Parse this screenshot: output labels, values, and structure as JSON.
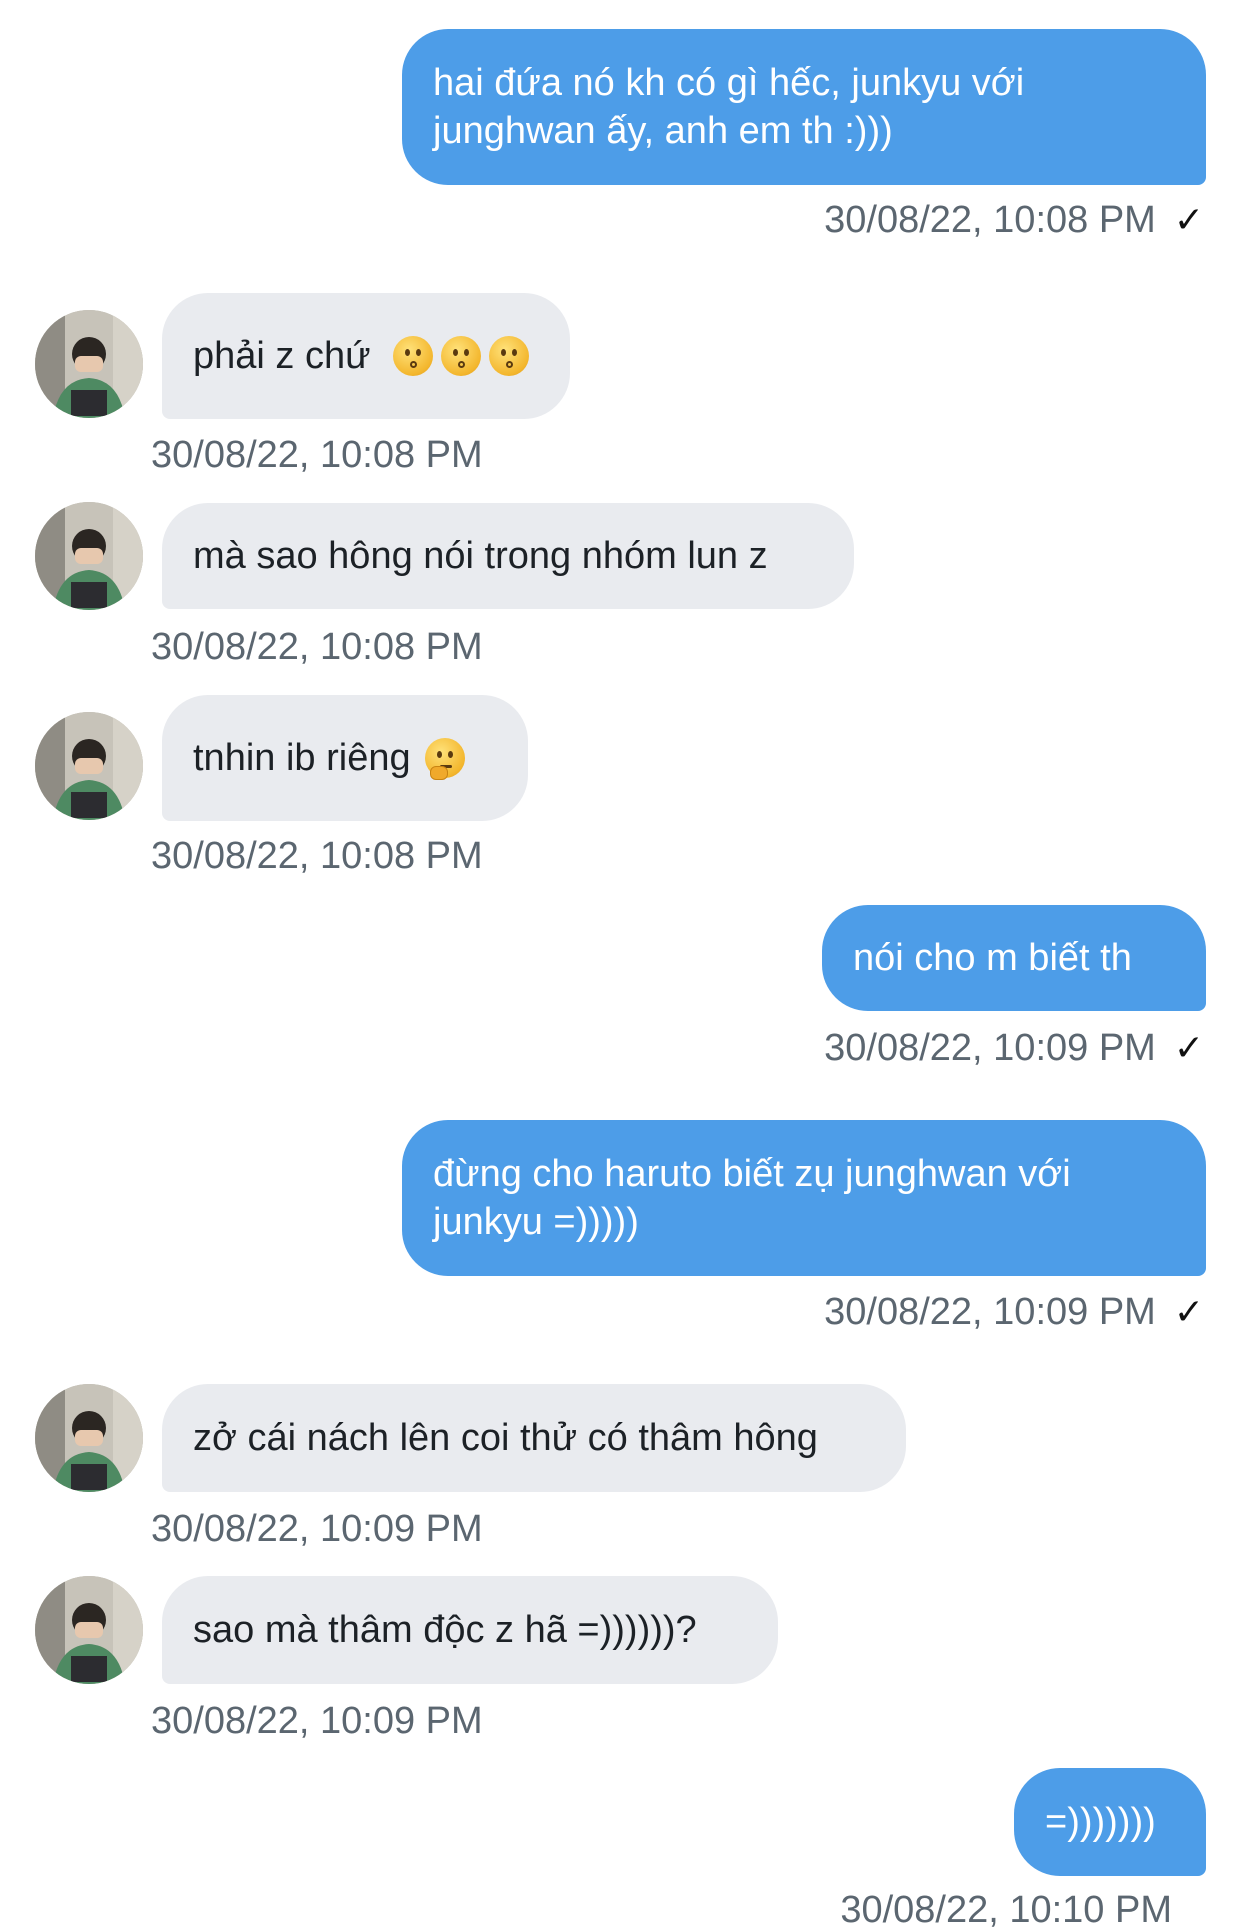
{
  "messages": [
    {
      "direction": "out",
      "text": "hai đứa nó kh có gì hếc, junkyu với junghwan ấy, anh em th :)))",
      "time": "30/08/22, 10:08 PM",
      "read_mark": "✓"
    },
    {
      "direction": "in",
      "text": "phải z chứ",
      "emoji": [
        "kissing-face-icon",
        "kissing-face-icon",
        "kissing-face-icon"
      ],
      "time": "30/08/22, 10:08 PM"
    },
    {
      "direction": "in",
      "text": "mà sao hông nói trong nhóm lun z",
      "time": "30/08/22, 10:08 PM"
    },
    {
      "direction": "in",
      "text": "tnhin ib riêng",
      "emoji": [
        "thinking-face-icon"
      ],
      "time": "30/08/22, 10:08 PM"
    },
    {
      "direction": "out",
      "text": "nói cho m biết th",
      "time": "30/08/22, 10:09 PM",
      "read_mark": "✓"
    },
    {
      "direction": "out",
      "text": "đừng cho haruto biết zụ junghwan với junkyu =)))))",
      "time": "30/08/22, 10:09 PM",
      "read_mark": "✓"
    },
    {
      "direction": "in",
      "text": "zở cái nách lên coi thử có thâm hông",
      "time": "30/08/22, 10:09 PM"
    },
    {
      "direction": "in",
      "text": "sao mà thâm độc z hã =))))))?",
      "time": "30/08/22, 10:09 PM"
    },
    {
      "direction": "out",
      "text": "=)))))))",
      "time": "30/08/22, 10:10 PM"
    }
  ],
  "colors": {
    "outgoing_bubble": "#4d9de8",
    "incoming_bubble": "#e9ebef",
    "timestamp": "#5b6670"
  }
}
